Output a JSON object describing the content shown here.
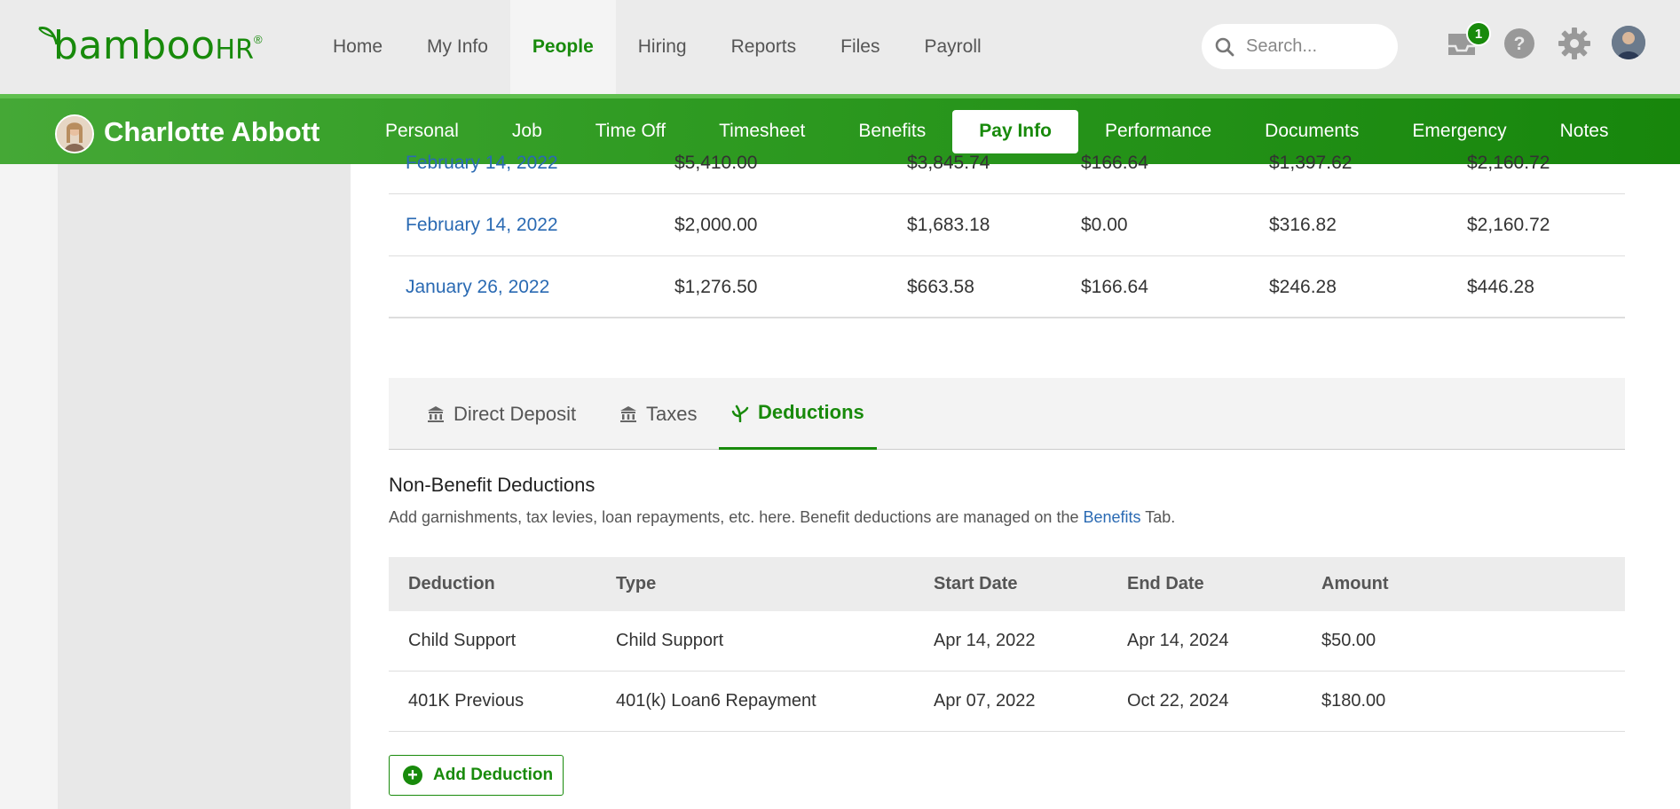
{
  "header": {
    "logo_text": "bamboo",
    "logo_hr": "HR",
    "logo_reg": "®",
    "nav": [
      {
        "label": "Home",
        "active": false
      },
      {
        "label": "My Info",
        "active": false
      },
      {
        "label": "People",
        "active": true
      },
      {
        "label": "Hiring",
        "active": false
      },
      {
        "label": "Reports",
        "active": false
      },
      {
        "label": "Files",
        "active": false
      },
      {
        "label": "Payroll",
        "active": false
      }
    ],
    "search_placeholder": "Search...",
    "inbox_count": "1",
    "icons": [
      "search-icon",
      "inbox-icon",
      "help-icon",
      "settings-icon",
      "user-avatar"
    ]
  },
  "employee": {
    "name": "Charlotte Abbott",
    "tabs": [
      {
        "label": "Personal",
        "active": false
      },
      {
        "label": "Job",
        "active": false
      },
      {
        "label": "Time Off",
        "active": false
      },
      {
        "label": "Timesheet",
        "active": false
      },
      {
        "label": "Benefits",
        "active": false
      },
      {
        "label": "Pay Info",
        "active": true
      },
      {
        "label": "Performance",
        "active": false
      },
      {
        "label": "Documents",
        "active": false
      },
      {
        "label": "Emergency",
        "active": false
      },
      {
        "label": "Notes",
        "active": false
      }
    ]
  },
  "paystubs": [
    {
      "date": "February 14, 2022",
      "gross": "$5,410.00",
      "net": "$3,845.74",
      "deductions": "$166.64",
      "taxes": "$1,397.62",
      "ytd": "$2,160.72"
    },
    {
      "date": "February 14, 2022",
      "gross": "$2,000.00",
      "net": "$1,683.18",
      "deductions": "$0.00",
      "taxes": "$316.82",
      "ytd": "$2,160.72"
    },
    {
      "date": "January 26, 2022",
      "gross": "$1,276.50",
      "net": "$663.58",
      "deductions": "$166.64",
      "taxes": "$246.28",
      "ytd": "$446.28"
    }
  ],
  "pay_tabs": [
    {
      "label": "Direct Deposit",
      "icon": "bank-icon",
      "active": false
    },
    {
      "label": "Taxes",
      "icon": "bank-icon",
      "active": false
    },
    {
      "label": "Deductions",
      "icon": "deductions-icon",
      "active": true
    }
  ],
  "deductions_section": {
    "title": "Non-Benefit Deductions",
    "desc_before": "Add garnishments, tax levies, loan repayments, etc. here. Benefit deductions are managed on the ",
    "desc_link": "Benefits",
    "desc_after": " Tab.",
    "columns": [
      "Deduction",
      "Type",
      "Start Date",
      "End Date",
      "Amount"
    ],
    "rows": [
      [
        "Child Support",
        "Child Support",
        "Apr 14, 2022",
        "Apr 14, 2024",
        "$50.00"
      ],
      [
        "401K Previous",
        "401(k) Loan6 Repayment",
        "Apr 07, 2022",
        "Oct 22, 2024",
        "$180.00"
      ]
    ],
    "add_button": "Add Deduction"
  },
  "colors": {
    "brand_green": "#188a0b",
    "link_blue": "#2a6ab3"
  }
}
